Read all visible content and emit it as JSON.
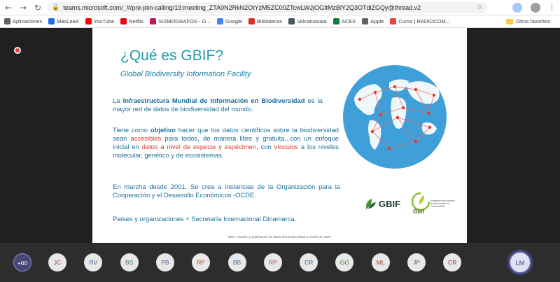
{
  "browser": {
    "url": "teams.microsoft.com/_#/pre-join-calling/19:meeting_ZTA0N2RkN2OtYzM5ZC00ZTcwLWJjOGItMzBlY2Q3OTdiZGQy@thread.v2",
    "nav": {
      "back": "←",
      "forward": "→",
      "reload": "↻"
    },
    "icons": {
      "lock": "🔒",
      "star": "☆",
      "menu": "⋮"
    },
    "bookmarks": [
      {
        "label": "Aplicaciones",
        "color": "#5f6368"
      },
      {
        "label": "MásLeaX",
        "color": "#1a73e8"
      },
      {
        "label": "YouTube",
        "color": "#ff0000"
      },
      {
        "label": "Netflix",
        "color": "#e50914"
      },
      {
        "label": "SISMOGRAFOS - G...",
        "color": "#c2185b"
      },
      {
        "label": "Google",
        "color": "#4285f4"
      },
      {
        "label": "Bibliotecas",
        "color": "#d93025"
      },
      {
        "label": "Volcanoloaia",
        "color": "#455a64"
      },
      {
        "label": "ACES",
        "color": "#0b8043"
      },
      {
        "label": "Apple",
        "color": "#5f6368"
      },
      {
        "label": "Curso | RADIOCOM...",
        "color": "#e8453c"
      }
    ],
    "bookmarks_other": "Otros favoritos"
  },
  "slide": {
    "title": "¿Qué es GBIF?",
    "subtitle": "Global Biodiversity Information Facility",
    "p1": {
      "a": "La ",
      "b": "Infraestructura Mundial de Información en Biodiversidad",
      "c": " es la mayor red de datos de biodiversidad del mundo."
    },
    "p2": {
      "a": "Tiene como ",
      "b": "objetivo",
      "c": " hacer que los datos científicos sobre la biodiversidad sean ",
      "d": "accesibles",
      "e": " para todos, de manera libre y gratuita...con un enfoque inicial en ",
      "f": "datos a nivel de especie y espécimen",
      "g": ", con ",
      "h": "vínculos",
      "i": " a los niveles molecular, genético y de ecosistemas."
    },
    "p3": "En marcha desde 2001. Se crea a instancias de la Organización para la Cooperación y el Desarrollo Económicos -OCDE.",
    "p4": "Países y organizaciones + Secretaría Internacional Dinamarca.",
    "footer": "Taller \"Gestión y publicación de datos de biodiversidad a través de GBIF\"",
    "logo_text": "GBIF",
    "logo2_text": "Gbif",
    "logo2_small": "Infraestructura mundial de información en biodiversidad"
  },
  "participants": {
    "more": "+60",
    "list": [
      "JC",
      "RV",
      "BS",
      "PB",
      "RF",
      "BB",
      "RP",
      "CR",
      "GG",
      "ML",
      "JP",
      "CR"
    ],
    "colors": [
      "#b0347c",
      "#3b5b9a",
      "#3a7a55",
      "#6b4f9c",
      "#b74a2f",
      "#3d6f8a",
      "#b83b74",
      "#2f5ea8",
      "#4b7a31",
      "#a8421e",
      "#3c6b58",
      "#a32e47"
    ],
    "self": "LM"
  }
}
